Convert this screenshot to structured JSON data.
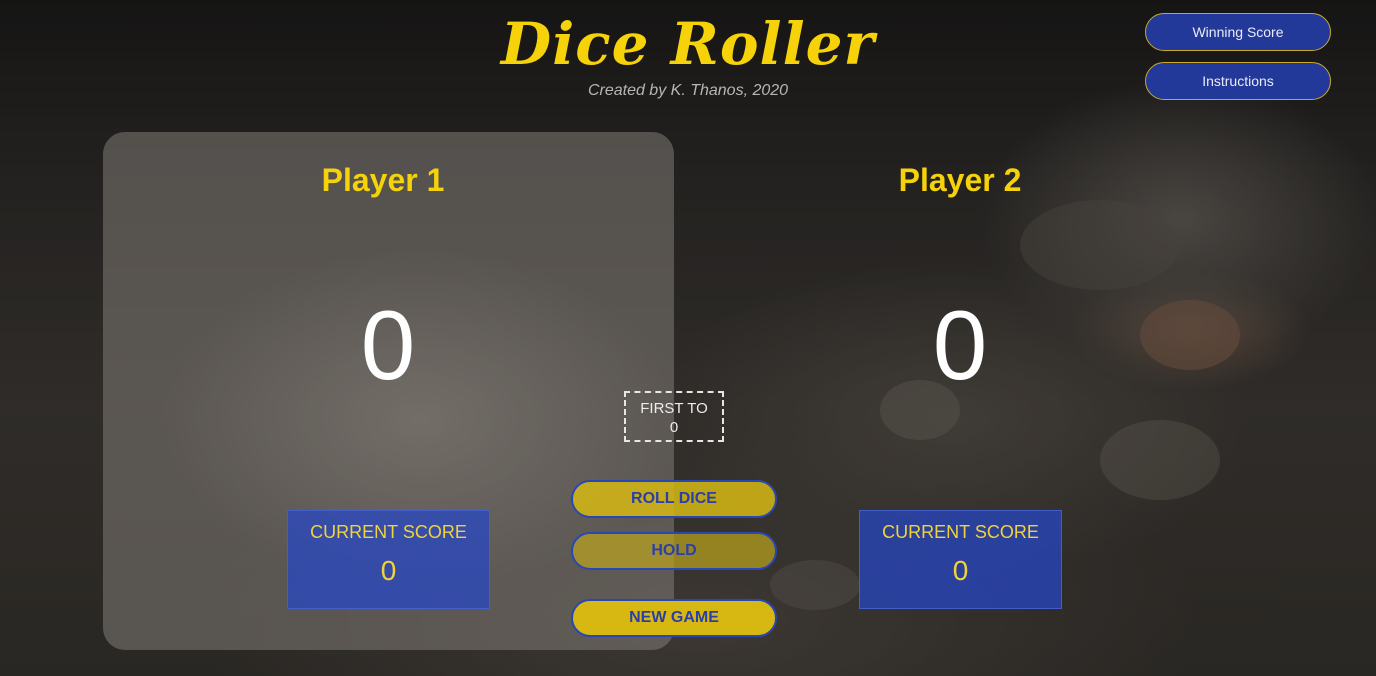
{
  "header": {
    "title": "Dice Roller",
    "subtitle": "Created by K. Thanos, 2020"
  },
  "top_buttons": {
    "winning_score": "Winning Score",
    "instructions": "Instructions"
  },
  "players": [
    {
      "name": "Player 1",
      "total": "0",
      "current_label": "CURRENT SCORE",
      "current": "0",
      "active": true
    },
    {
      "name": "Player 2",
      "total": "0",
      "current_label": "CURRENT SCORE",
      "current": "0",
      "active": false
    }
  ],
  "target": {
    "label": "FIRST TO",
    "value": "0"
  },
  "actions": {
    "roll": "ROLL DICE",
    "hold": "HOLD",
    "new_game": "NEW GAME"
  },
  "colors": {
    "accent_yellow": "#f5d20a",
    "accent_blue": "#23399a"
  }
}
